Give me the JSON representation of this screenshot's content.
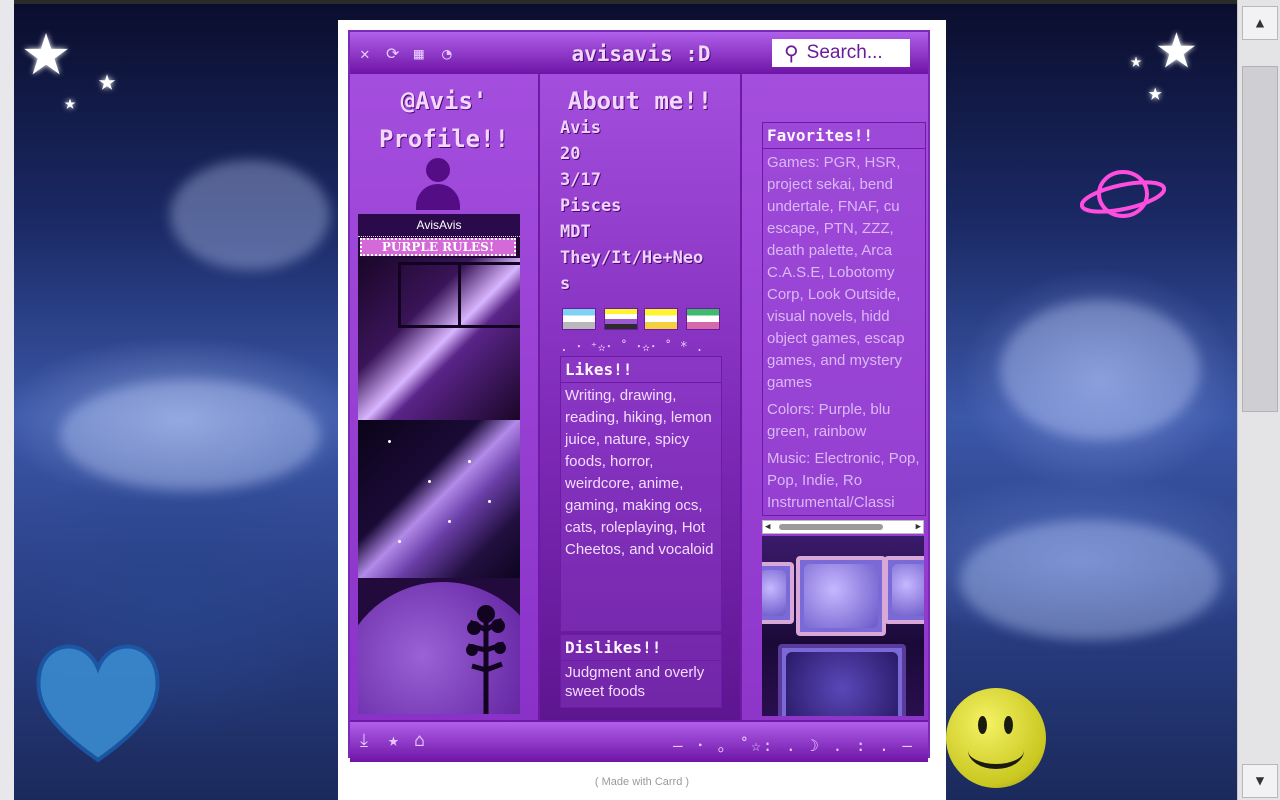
{
  "header": {
    "site_title": "avisavis :D",
    "search_label": "Search..."
  },
  "profile": {
    "title_line1": "@Avis'",
    "title_line2": "Profile!!",
    "banner_name": "AvisAvis",
    "banner_rule": "PURPLE RULES!"
  },
  "about": {
    "title": "About me!!",
    "lines": [
      "Avis",
      "20",
      "3/17",
      "Pisces",
      "MDT",
      "They/It/He+Neo",
      "s"
    ],
    "flags": [
      {
        "name": "demiboy-flag",
        "colors": [
          "#7dd3f0",
          "#ffffff",
          "#b9b9b9"
        ]
      },
      {
        "name": "nonbinary-flag",
        "colors": [
          "#fff430",
          "#ffffff",
          "#9c59d1",
          "#2c2c2c"
        ]
      },
      {
        "name": "intersex-style-flag",
        "colors": [
          "#fff430",
          "#ffffff",
          "#f4d03f"
        ]
      },
      {
        "name": "rainbow-green-flag",
        "colors": [
          "#3fb96b",
          "#ffffff",
          "#d46aa8"
        ]
      }
    ],
    "deco_stars": ". ･ ⁺✫･ ˚ ･✫･ ˚ * ."
  },
  "likes": {
    "title": "Likes!!",
    "text": "Writing, drawing, reading, hiking, lemon juice, nature, spicy foods, horror, weirdcore, anime, gaming, making ocs, cats, roleplaying, Hot Cheetos, and vocaloid"
  },
  "dislikes": {
    "title": "Dislikes!!",
    "text": "Judgment and overly sweet foods"
  },
  "favorites": {
    "title": "Favorites!!",
    "games": "Games: PGR, HSR, project sekai, bend undertale, FNAF, cu escape, PTN, ZZZ, death palette, Arca C.A.S.E, Lobotomy Corp, Look Outside, visual novels, hidd object games, escap games, and mystery games",
    "colors": "Colors: Purple, blu green, rainbow",
    "music": "Music: Electronic, Pop, Pop, Indie, Ro Instrumental/Classi"
  },
  "footer": {
    "deco": "— ･ ｡ ˚☆: . ☽ . : . —"
  },
  "made_with": "( Made with Carrd )",
  "colors": {
    "accent": "#9d45d6",
    "dark_purple": "#6e14a6",
    "text_light": "#f0d2ff"
  },
  "icons": [
    "close-icon",
    "refresh-icon",
    "calendar-icon",
    "rss-icon",
    "search-icon",
    "download-icon",
    "star-icon",
    "home-icon"
  ]
}
